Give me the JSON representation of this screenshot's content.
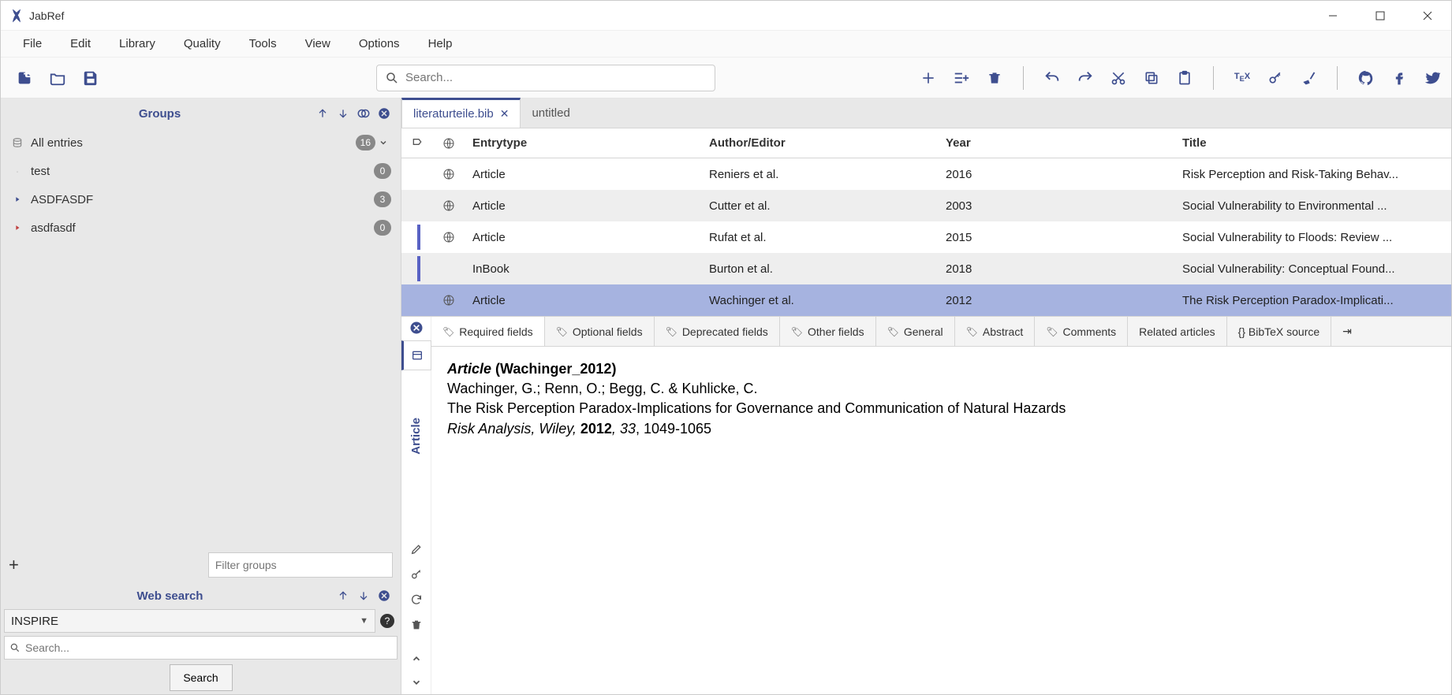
{
  "app": {
    "title": "JabRef"
  },
  "menu": [
    "File",
    "Edit",
    "Library",
    "Quality",
    "Tools",
    "View",
    "Options",
    "Help"
  ],
  "search": {
    "placeholder": "Search..."
  },
  "tabs": [
    {
      "label": "literaturteile.bib",
      "active": true
    },
    {
      "label": "untitled",
      "active": false
    }
  ],
  "columns": {
    "entrytype": "Entrytype",
    "author": "Author/Editor",
    "year": "Year",
    "title": "Title"
  },
  "rows": [
    {
      "entrytype": "Article",
      "author": "Reniers et al.",
      "year": "2016",
      "title": "Risk Perception and Risk-Taking Behav...",
      "mark": false,
      "globe": true
    },
    {
      "entrytype": "Article",
      "author": "Cutter et al.",
      "year": "2003",
      "title": "Social Vulnerability to Environmental ...",
      "mark": false,
      "globe": true
    },
    {
      "entrytype": "Article",
      "author": "Rufat et al.",
      "year": "2015",
      "title": "Social Vulnerability to Floods: Review ...",
      "mark": true,
      "globe": true
    },
    {
      "entrytype": "InBook",
      "author": "Burton et al.",
      "year": "2018",
      "title": "Social Vulnerability: Conceptual Found...",
      "mark": true,
      "globe": false
    },
    {
      "entrytype": "Article",
      "author": "Wachinger et al.",
      "year": "2012",
      "title": "The Risk Perception Paradox-Implicati...",
      "mark": false,
      "globe": true,
      "selected": true
    }
  ],
  "groups": {
    "header": "Groups",
    "items": [
      {
        "name": "All entries",
        "count": "16",
        "type": "root"
      },
      {
        "name": "test",
        "count": "0",
        "type": "leaf"
      },
      {
        "name": "ASDFASDF",
        "count": "3",
        "type": "branch"
      },
      {
        "name": "asdfasdf",
        "count": "0",
        "type": "branchopen"
      }
    ],
    "filter_placeholder": "Filter groups"
  },
  "websearch": {
    "header": "Web search",
    "source": "INSPIRE",
    "placeholder": "Search...",
    "button": "Search"
  },
  "editor": {
    "vlabel": "Article",
    "tabs": [
      "Required fields",
      "Optional fields",
      "Deprecated fields",
      "Other fields",
      "General",
      "Abstract",
      "Comments",
      "Related articles",
      "{} BibTeX source"
    ],
    "entry": {
      "type": "Article",
      "key": "(Wachinger_2012)",
      "authors": "Wachinger, G.; Renn, O.; Begg, C. & Kuhlicke, C.",
      "title": "The Risk Perception Paradox-Implications for Governance and Communication of Natural Hazards",
      "journal": "Risk Analysis, Wiley, ",
      "year": "2012",
      "vol": "33",
      "pages": "1049-1065"
    }
  }
}
